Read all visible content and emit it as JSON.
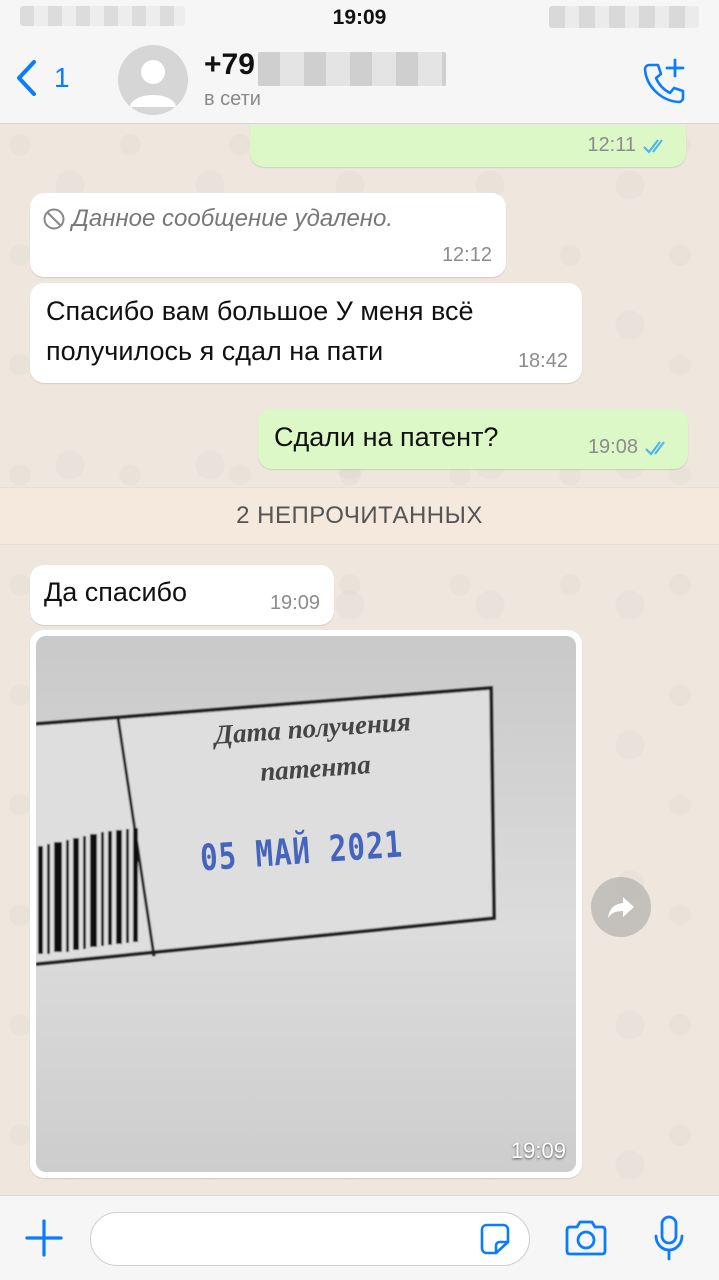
{
  "status_bar": {
    "time": "19:09"
  },
  "header": {
    "back_count": "1",
    "contact_name": "+79",
    "contact_status": "в сети"
  },
  "messages": [
    {
      "direction": "out",
      "text": "",
      "time": "12:11",
      "read": true
    },
    {
      "direction": "in",
      "text": "Данное сообщение удалено.",
      "time": "12:12",
      "deleted": true
    },
    {
      "direction": "in",
      "text": "Спасибо вам большое У меня всё получилось  я сдал на пати",
      "time": "18:42"
    },
    {
      "direction": "out",
      "text": "Сдали на патент?",
      "time": "19:08",
      "read": true
    },
    {
      "direction": "in",
      "text": "Да спасибо",
      "time": "19:09"
    },
    {
      "direction": "in",
      "type": "image",
      "time": "19:09",
      "image_text": {
        "line1": "Дата получения",
        "line2": "патента",
        "stamp": "05 МАЙ 2021"
      }
    }
  ],
  "unread_banner": "2 НЕПРОЧИТАННЫХ",
  "input": {
    "placeholder": "",
    "value": ""
  },
  "colors": {
    "accent": "#0a7cff",
    "outgoing": "#dcf8c6",
    "incoming": "#ffffff",
    "read_ticks": "#4fb6ec",
    "stamp": "#2a4fb8"
  }
}
